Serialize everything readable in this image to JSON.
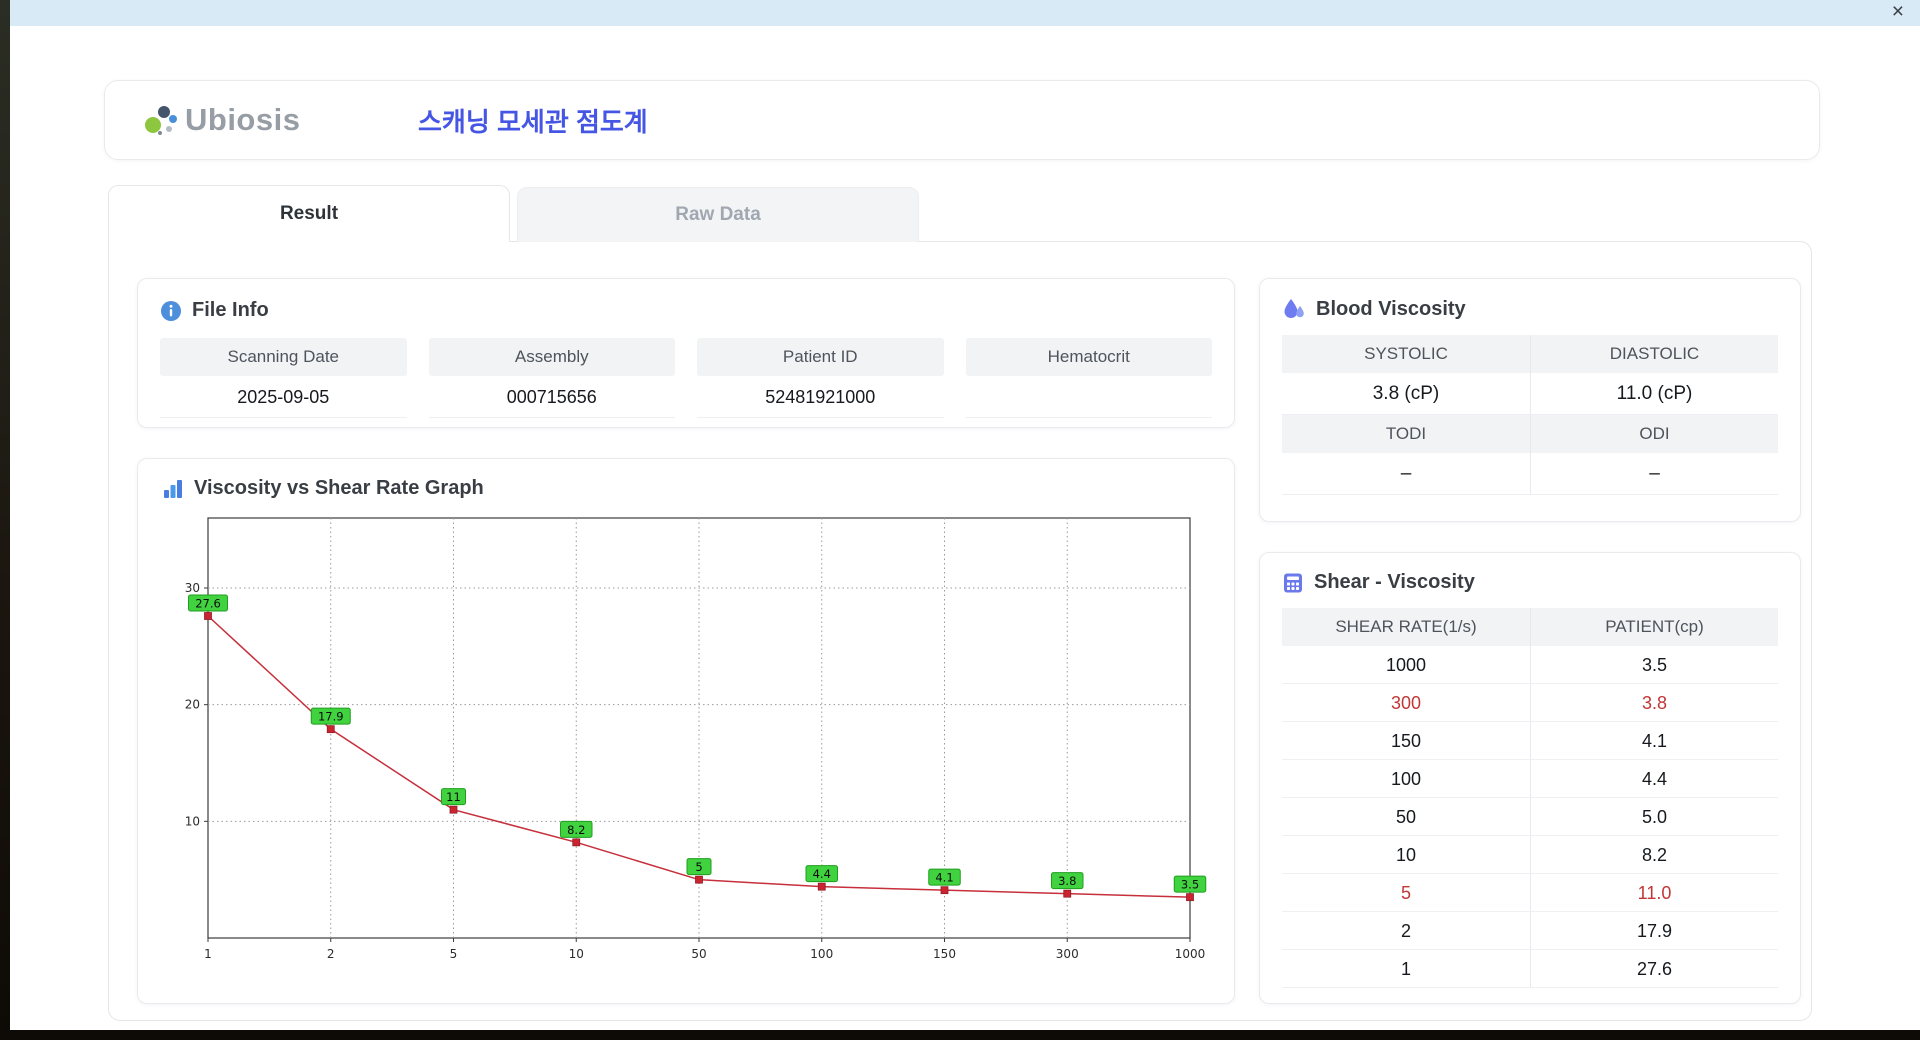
{
  "window": {
    "close_label": "×"
  },
  "header": {
    "logo_text": "Ubiosis",
    "title": "스캐닝 모세관 점도계"
  },
  "tabs": [
    {
      "label": "Result",
      "active": true
    },
    {
      "label": "Raw Data",
      "active": false
    }
  ],
  "file_info": {
    "title": "File Info",
    "fields": [
      {
        "label": "Scanning Date",
        "value": "2025-09-05"
      },
      {
        "label": "Assembly",
        "value": "000715656"
      },
      {
        "label": "Patient ID",
        "value": "52481921000"
      },
      {
        "label": "Hematocrit",
        "value": ""
      }
    ]
  },
  "graph": {
    "title": "Viscosity vs Shear Rate Graph"
  },
  "blood_viscosity": {
    "title": "Blood Viscosity",
    "rows": [
      {
        "headers": [
          "SYSTOLIC",
          "DIASTOLIC"
        ],
        "values": [
          "3.8 (cP)",
          "11.0 (cP)"
        ]
      },
      {
        "headers": [
          "TODI",
          "ODI"
        ],
        "values": [
          "–",
          "–"
        ]
      }
    ]
  },
  "shear_viscosity": {
    "title": "Shear - Viscosity",
    "columns": [
      "SHEAR RATE(1/s)",
      "PATIENT(cp)"
    ],
    "rows": [
      {
        "shear_rate": "1000",
        "patient": "3.5",
        "highlight": false
      },
      {
        "shear_rate": "300",
        "patient": "3.8",
        "highlight": true
      },
      {
        "shear_rate": "150",
        "patient": "4.1",
        "highlight": false
      },
      {
        "shear_rate": "100",
        "patient": "4.4",
        "highlight": false
      },
      {
        "shear_rate": "50",
        "patient": "5.0",
        "highlight": false
      },
      {
        "shear_rate": "10",
        "patient": "8.2",
        "highlight": false
      },
      {
        "shear_rate": "5",
        "patient": "11.0",
        "highlight": true
      },
      {
        "shear_rate": "2",
        "patient": "17.9",
        "highlight": false
      },
      {
        "shear_rate": "1",
        "patient": "27.6",
        "highlight": false
      }
    ]
  },
  "chart_data": {
    "type": "line",
    "title": "Viscosity vs Shear Rate Graph",
    "categories": [
      "1",
      "2",
      "5",
      "10",
      "50",
      "100",
      "150",
      "300",
      "1000"
    ],
    "values": [
      27.6,
      17.9,
      11,
      8.2,
      5,
      4.4,
      4.1,
      3.8,
      3.5
    ],
    "point_labels": [
      "27.6",
      "17.9",
      "11",
      "8.2",
      "5",
      "4.4",
      "4.1",
      "3.8",
      "3.5"
    ],
    "xlabel": "",
    "ylabel": "",
    "y_ticks": [
      10,
      20,
      30
    ],
    "ylim": [
      0,
      36
    ],
    "x_spacing": "equal",
    "grid": true,
    "legend": false,
    "line_color": "#c62f3b",
    "marker_color": "#cc2330",
    "label_bg": "#41d23f",
    "label_border": "#1f9e1f"
  },
  "icons": {
    "logo": "ubiosis-dots-icon",
    "file_info": "info-circle-icon",
    "graph": "bar-chart-icon",
    "blood_viscosity": "water-drops-icon",
    "shear_viscosity": "calculator-grid-icon",
    "window_close": "close-icon"
  },
  "colors": {
    "accent_blue": "#4556e4",
    "titlebar": "#d8eaf6",
    "highlight_red": "#c23636",
    "header_cell_bg": "#f2f3f5",
    "label_green": "#41d23f",
    "line_red": "#c62f3b"
  }
}
